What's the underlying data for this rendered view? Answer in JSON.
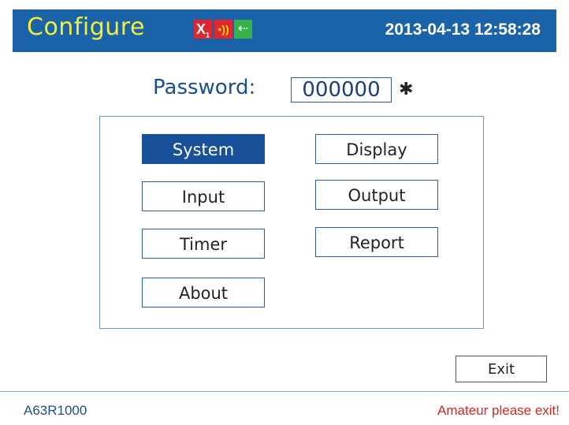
{
  "header": {
    "title": "Configure",
    "clock": "2013-04-13 12:58:28",
    "icons": {
      "alarm": "X",
      "alarm_sub": "1",
      "signal": "•))",
      "usb": "⇠"
    }
  },
  "password": {
    "label": "Password:",
    "value": "000000",
    "marker": "✱"
  },
  "menu": {
    "system": "System",
    "display": "Display",
    "input": "Input",
    "output": "Output",
    "timer": "Timer",
    "report": "Report",
    "about": "About",
    "selected": "System"
  },
  "exit_label": "Exit",
  "footer": {
    "model": "A63R1000",
    "status": "Amateur please exit!"
  },
  "colors": {
    "header_bg": "#1a63a8",
    "title_color": "#f3f03a",
    "selected_bg": "#18509a",
    "status_color": "#d22727"
  }
}
